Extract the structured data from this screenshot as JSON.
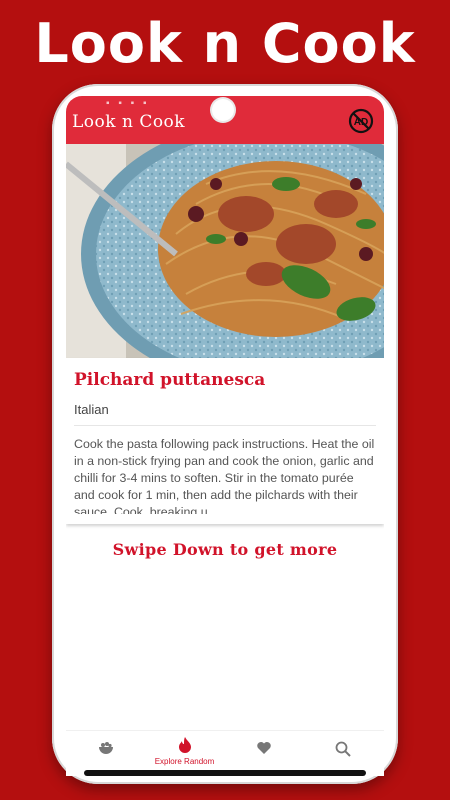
{
  "promo": {
    "title": "Look n Cook"
  },
  "appbar": {
    "title": "Look n Cook",
    "noad_icon": "no-ad-icon",
    "noad_text": "AD"
  },
  "recipe": {
    "name": "Pilchard puttanesca",
    "cuisine": "Italian",
    "instructions": "Cook the pasta following pack instructions. Heat the oil in a non-stick frying pan and cook the onion, garlic and chilli for 3-4 mins to soften. Stir in the tomato purée and cook for 1 min, then add the pilchards with their sauce. Cook, breaking u..."
  },
  "swipe_hint": "Swipe Down to get more",
  "nav": {
    "items": [
      {
        "icon": "bowl-icon",
        "label": ""
      },
      {
        "icon": "fire-icon",
        "label": "Explore Random"
      },
      {
        "icon": "heart-icon",
        "label": ""
      },
      {
        "icon": "search-icon",
        "label": ""
      }
    ]
  },
  "colors": {
    "background": "#b40f0f",
    "accent": "#e02b3a",
    "title_red": "#d1132a"
  }
}
